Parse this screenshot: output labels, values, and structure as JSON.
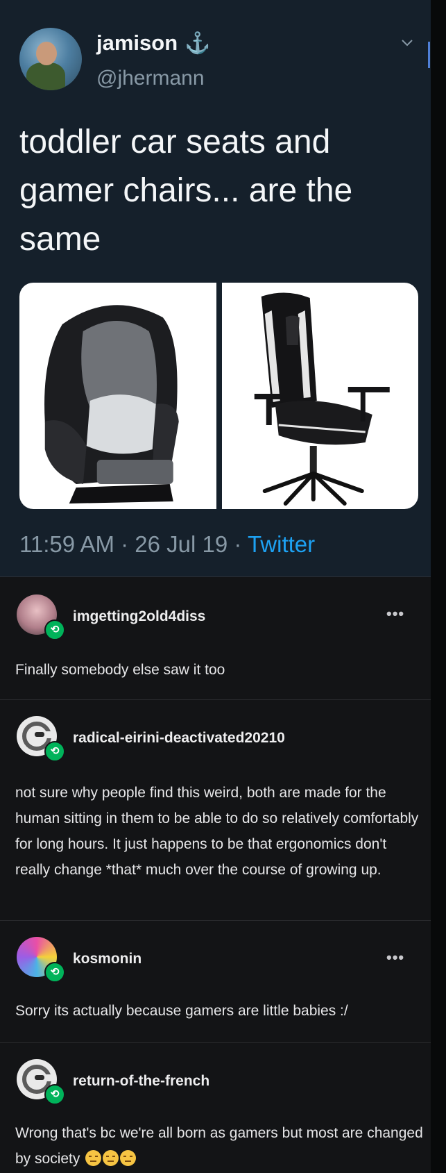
{
  "tweet": {
    "display_name": "jamison",
    "name_icon": "anchor-icon",
    "handle": "@jhermann",
    "text": "toddler car seats and gamer chairs... are the same",
    "timestamp": "11:59 AM · 26 Jul 19 · ",
    "source": "Twitter",
    "media": [
      "toddler car seat photo",
      "gamer chair photo"
    ]
  },
  "reblogs": [
    {
      "username": "imgetting2old4diss",
      "body": "Finally somebody else saw it too",
      "has_menu": true,
      "more_label": "•••"
    },
    {
      "username": "radical-eirini-deactivated20210",
      "body": "not sure why people find this weird, both are made for the human sitting in them to be able to do so relatively comfortably for long hours. It just happens to be that ergonomics don't really change *that* much over the course of growing up.",
      "has_menu": false
    },
    {
      "username": "kosmonin",
      "body": "Sorry its actually because gamers are little babies :/",
      "has_menu": true,
      "more_label": "•••"
    },
    {
      "username": "return-of-the-french",
      "body": "Wrong that's bc we're all born as gamers but most are changed by society",
      "has_menu": false
    }
  ],
  "colors": {
    "tweet_bg": "#15202b",
    "tumblr_bg": "#131416",
    "link_blue": "#1da1f2",
    "reblog_green": "#00b35a"
  }
}
